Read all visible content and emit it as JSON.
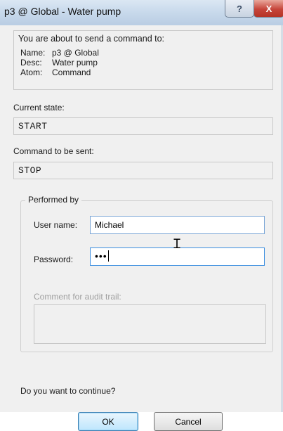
{
  "window": {
    "title": "p3 @ Global - Water pump",
    "help_glyph": "?",
    "close_glyph": "X"
  },
  "info": {
    "header": "You are about to send a command to:",
    "rows": [
      {
        "key": "Name:",
        "value": "p3 @ Global"
      },
      {
        "key": "Desc:",
        "value": "Water pump"
      },
      {
        "key": "Atom:",
        "value": "Command"
      }
    ]
  },
  "current_state": {
    "label": "Current state:",
    "value": "START"
  },
  "command": {
    "label": "Command to be sent:",
    "value": "STOP"
  },
  "performed_by": {
    "legend": "Performed by",
    "username_label": "User name:",
    "username_value": "Michael",
    "password_label": "Password:",
    "password_value": "•••",
    "comment_label": "Comment for audit trail:"
  },
  "question": "Do you want to continue?",
  "buttons": {
    "ok": "OK",
    "cancel": "Cancel"
  }
}
